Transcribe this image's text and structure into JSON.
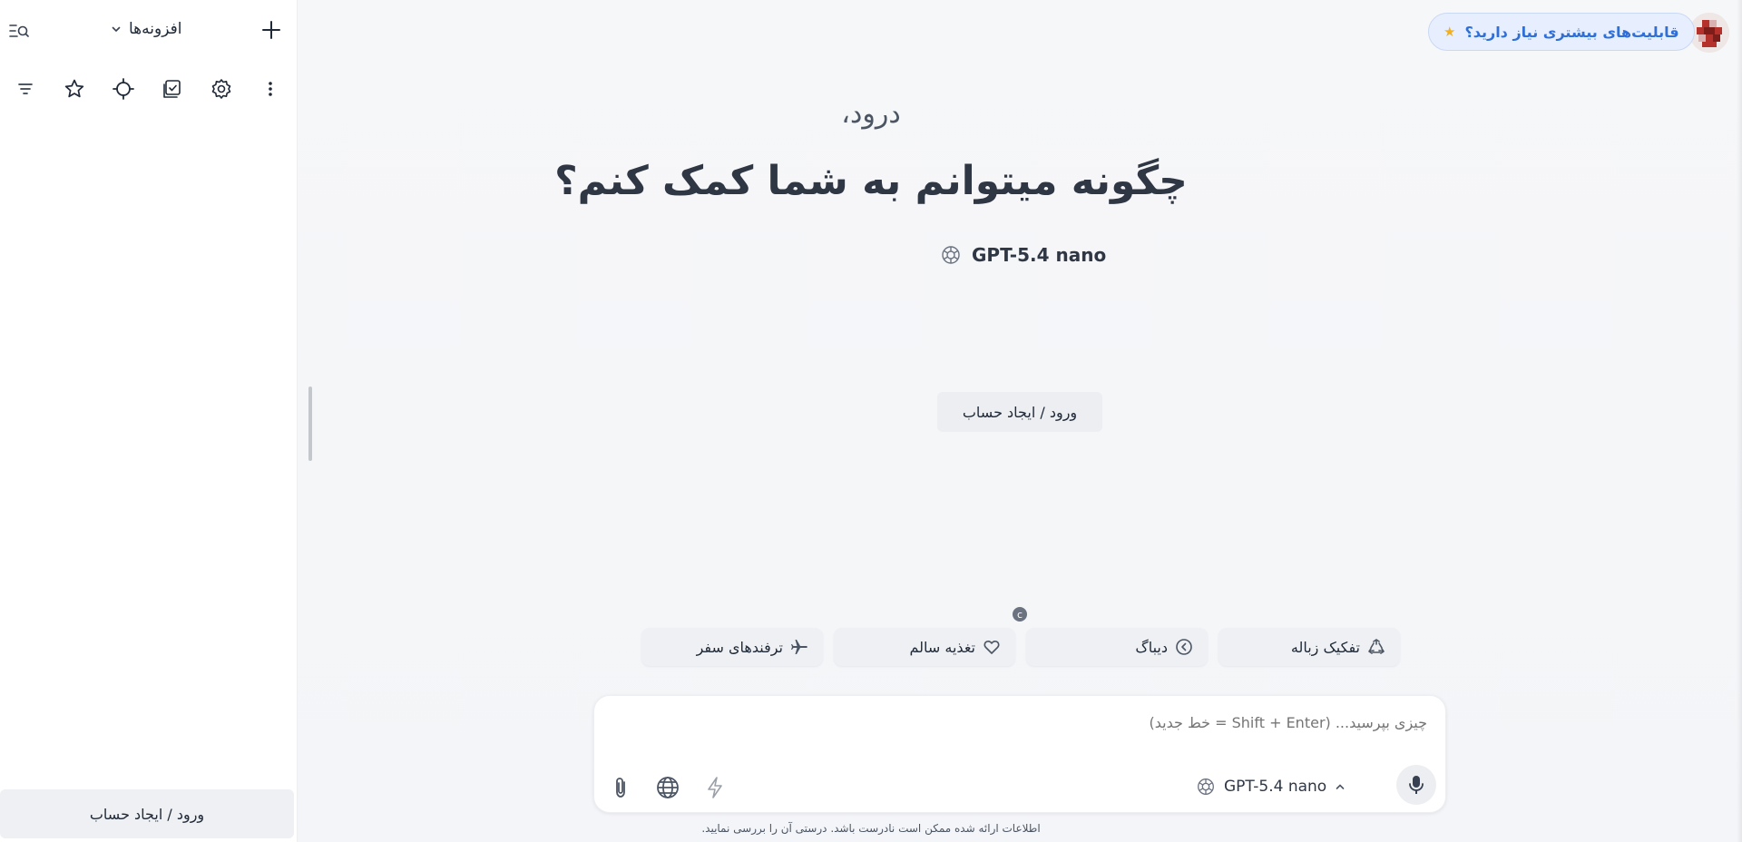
{
  "sidebar": {
    "title": "افزونه‌ها",
    "login_label": "ورود / ایجاد حساب",
    "tools": [
      "filter-icon",
      "star-icon",
      "crosshair-icon",
      "checklist-icon",
      "gear-icon",
      "more-vertical-icon"
    ]
  },
  "header": {
    "upgrade_label": "قابلیت‌های بیشتری نیاز دارید؟",
    "upgrade_star": "★"
  },
  "main": {
    "greeting": "درود،",
    "question": "چگونه میتوانم به شما کمک کنم؟",
    "model_name": "GPT-5.4 nano",
    "login_label": "ورود / ایجاد حساب",
    "badge": "c"
  },
  "suggestions": [
    {
      "label": "تفکیک زباله",
      "icon": "recycle-icon"
    },
    {
      "label": "دیباگ",
      "icon": "chevron-circle-icon"
    },
    {
      "label": "تغذیه سالم",
      "icon": "heart-icon"
    },
    {
      "label": "ترفندهای سفر",
      "icon": "airplane-icon"
    }
  ],
  "composer": {
    "placeholder": "چیزی بپرسید... (Shift + Enter = خط جدید)",
    "model_name": "GPT-5.4 nano"
  },
  "footer": {
    "disclaimer": "اطلاعات ارائه شده ممکن است نادرست باشد. درستی آن را بررسی نمایید."
  },
  "colors": {
    "accent": "#2f6fd6",
    "star": "#f2b01e",
    "avatar_red": "#b5312c"
  }
}
